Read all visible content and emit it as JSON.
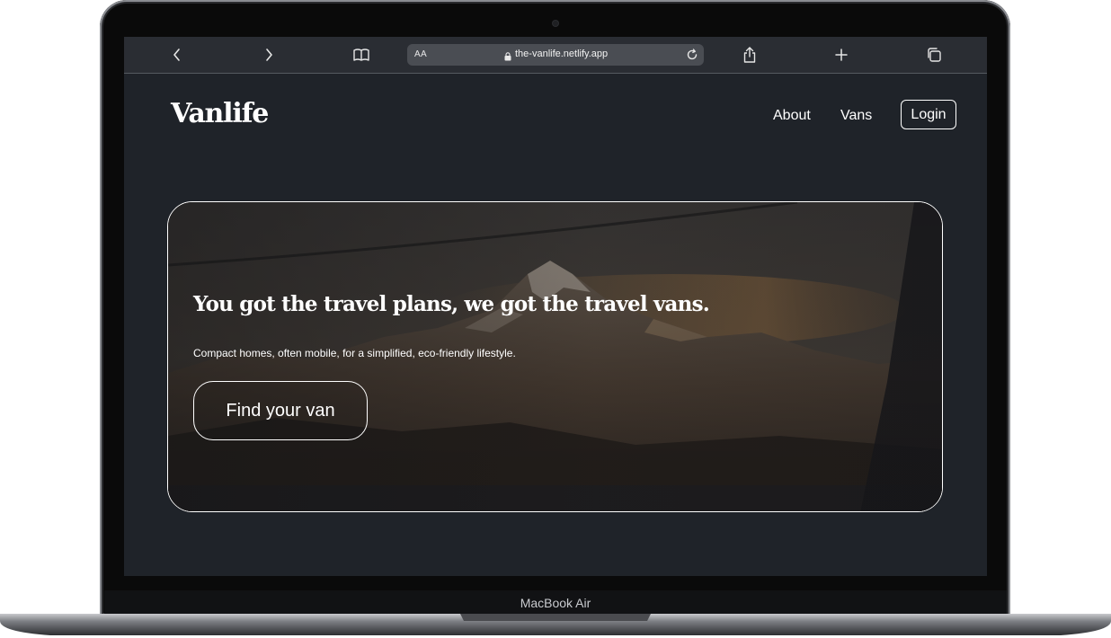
{
  "device": {
    "label": "MacBook Air"
  },
  "browser": {
    "text_size_label": "AA",
    "url": "the-vanlife.netlify.app",
    "icons": [
      "back-icon",
      "forward-icon",
      "bookmarks-icon",
      "lock-icon",
      "reload-icon",
      "share-icon",
      "new-tab-icon",
      "tabs-icon"
    ]
  },
  "site": {
    "logo": "Vanlife",
    "nav": {
      "about": "About",
      "vans": "Vans",
      "login": "Login"
    },
    "hero": {
      "title": "You got the travel plans, we got the travel vans.",
      "subtitle": "Compact homes, often mobile, for a simplified, eco-friendly lifestyle.",
      "cta": "Find your van"
    }
  },
  "colors": {
    "page_background": "#1f2329",
    "browser_bar": "#2a2d33",
    "text": "#ffffff",
    "hero_border": "#ffffff"
  }
}
